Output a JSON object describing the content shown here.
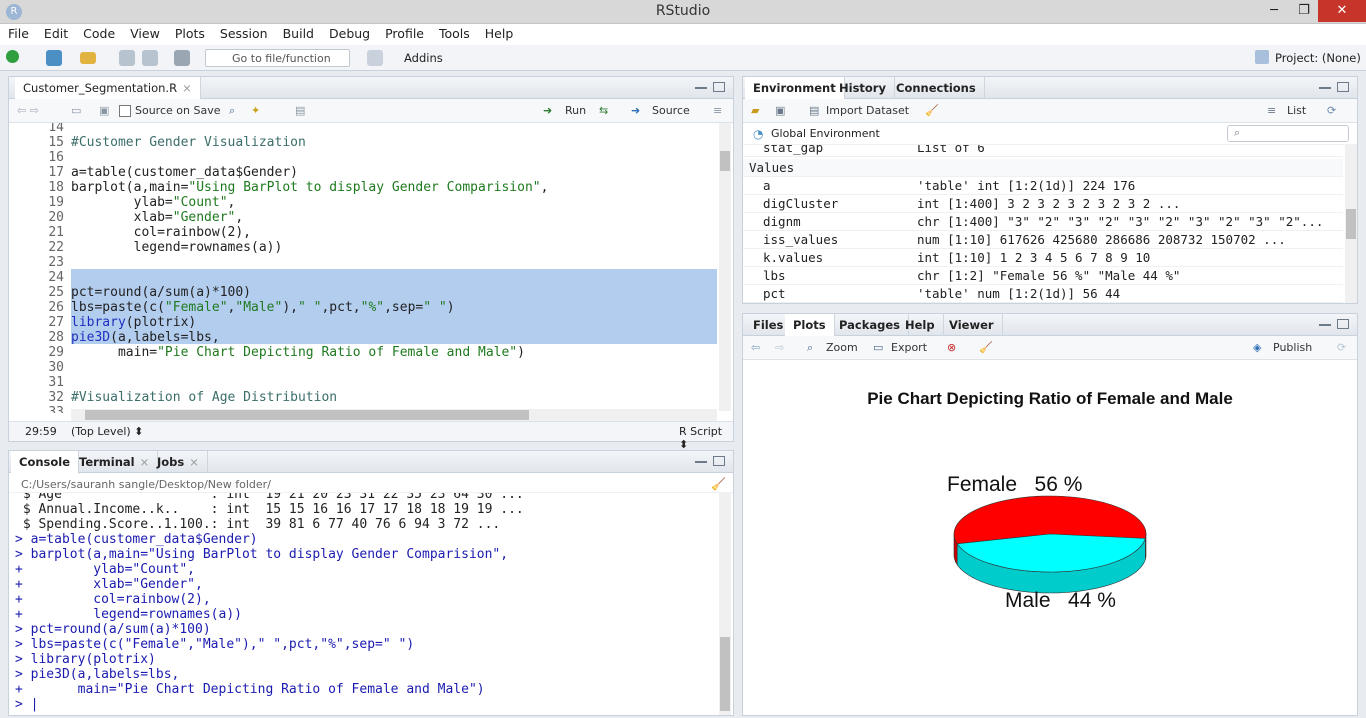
{
  "window": {
    "title": "RStudio",
    "logo": "R",
    "min": "─",
    "restore": "❐",
    "close": "✕"
  },
  "menu": [
    "File",
    "Edit",
    "Code",
    "View",
    "Plots",
    "Session",
    "Build",
    "Debug",
    "Profile",
    "Tools",
    "Help"
  ],
  "toolbar": {
    "goto_placeholder": "Go to file/function",
    "addins": "Addins",
    "project": "Project: (None)"
  },
  "editor": {
    "tab": "Customer_Segmentation.R",
    "source_on_save": "Source on Save",
    "run": "Run",
    "source": "Source",
    "lines": [
      {
        "n": "14",
        "t": ""
      },
      {
        "n": "15",
        "t": "#Customer Gender Visualization"
      },
      {
        "n": "16",
        "t": ""
      },
      {
        "n": "17",
        "t": "a=table(customer_data$Gender)"
      },
      {
        "n": "18",
        "t": "barplot(a,main=\"Using BarPlot to display Gender Comparision\","
      },
      {
        "n": "19",
        "t": "        ylab=\"Count\","
      },
      {
        "n": "20",
        "t": "        xlab=\"Gender\","
      },
      {
        "n": "21",
        "t": "        col=rainbow(2),"
      },
      {
        "n": "22",
        "t": "        legend=rownames(a))"
      },
      {
        "n": "23",
        "t": ""
      },
      {
        "n": "24",
        "t": ""
      },
      {
        "n": "25",
        "t": "pct=round(a/sum(a)*100)"
      },
      {
        "n": "26",
        "t": "lbs=paste(c(\"Female\",\"Male\"),\" \",pct,\"%\",sep=\" \")"
      },
      {
        "n": "27",
        "t": "library(plotrix)"
      },
      {
        "n": "28",
        "t": "pie3D(a,labels=lbs,"
      },
      {
        "n": "29",
        "t": "      main=\"Pie Chart Depicting Ratio of Female and Male\")"
      },
      {
        "n": "30",
        "t": ""
      },
      {
        "n": "31",
        "t": ""
      },
      {
        "n": "32",
        "t": "#Visualization of Age Distribution"
      },
      {
        "n": "33",
        "t": ""
      }
    ],
    "status_pos": "29:59",
    "status_scope": "(Top Level) ⬍",
    "status_type": "R Script ⬍"
  },
  "console": {
    "tabs": [
      "Console",
      "Terminal",
      "Jobs"
    ],
    "path": "C:/Users/sauranh sangle/Desktop/New folder/",
    "lines": [
      {
        "t": "out",
        "s": " $ Age                   : int  19 21 20 23 31 22 35 23 64 30 ..."
      },
      {
        "t": "out",
        "s": " $ Annual.Income..k..    : int  15 15 16 16 17 17 18 18 19 19 ..."
      },
      {
        "t": "out",
        "s": " $ Spending.Score..1.100.: int  39 81 6 77 40 76 6 94 3 72 ..."
      },
      {
        "t": "in",
        "s": "> a=table(customer_data$Gender)"
      },
      {
        "t": "in",
        "s": "> barplot(a,main=\"Using BarPlot to display Gender Comparision\","
      },
      {
        "t": "in",
        "s": "+         ylab=\"Count\","
      },
      {
        "t": "in",
        "s": "+         xlab=\"Gender\","
      },
      {
        "t": "in",
        "s": "+         col=rainbow(2),"
      },
      {
        "t": "in",
        "s": "+         legend=rownames(a))"
      },
      {
        "t": "in",
        "s": "> pct=round(a/sum(a)*100)"
      },
      {
        "t": "in",
        "s": "> lbs=paste(c(\"Female\",\"Male\"),\" \",pct,\"%\",sep=\" \")"
      },
      {
        "t": "in",
        "s": "> library(plotrix)"
      },
      {
        "t": "in",
        "s": "> pie3D(a,labels=lbs,"
      },
      {
        "t": "in",
        "s": "+       main=\"Pie Chart Depicting Ratio of Female and Male\")"
      },
      {
        "t": "in",
        "s": "> |"
      }
    ]
  },
  "environment": {
    "tabs": [
      "Environment",
      "History",
      "Connections"
    ],
    "import": "Import Dataset",
    "list": "List",
    "scope": "Global Environment",
    "partial": {
      "n": "stat_gap",
      "v": "List of 6"
    },
    "section": "Values",
    "rows": [
      {
        "n": "a",
        "v": "'table' int [1:2(1d)] 224 176"
      },
      {
        "n": "digCluster",
        "v": "int [1:400] 3 2 3 2 3 2 3 2 3 2 ..."
      },
      {
        "n": "dignm",
        "v": "chr [1:400] \"3\" \"2\" \"3\" \"2\" \"3\" \"2\" \"3\" \"2\" \"3\" \"2\"..."
      },
      {
        "n": "iss_values",
        "v": "num [1:10] 617626 425680 286686 208732 150702 ..."
      },
      {
        "n": "k.values",
        "v": "int [1:10] 1 2 3 4 5 6 7 8 9 10"
      },
      {
        "n": "lbs",
        "v": "chr [1:2] \"Female 56 %\" \"Male 44 %\""
      },
      {
        "n": "pct",
        "v": "'table' num [1:2(1d)] 56 44"
      }
    ]
  },
  "files": {
    "tabs": [
      "Files",
      "Plots",
      "Packages",
      "Help",
      "Viewer"
    ],
    "zoom": "Zoom",
    "export": "Export",
    "publish": "Publish"
  },
  "chart_data": {
    "type": "pie",
    "title": "Pie Chart Depicting Ratio of Female and Male",
    "categories": [
      "Female",
      "Male"
    ],
    "values": [
      56,
      44
    ],
    "labels": [
      "Female   56 %",
      "Male   44 %"
    ],
    "colors": [
      "#ff0000",
      "#00ffff"
    ]
  }
}
